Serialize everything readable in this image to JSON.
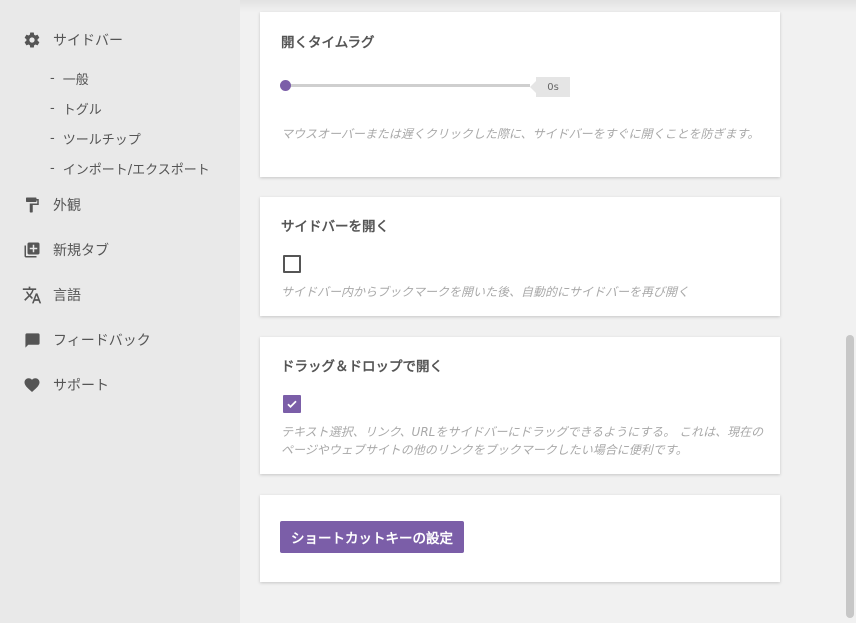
{
  "sidebar": {
    "items": [
      {
        "label": "サイドバー",
        "icon": "gear-icon"
      },
      {
        "label": "外観",
        "icon": "paint-roller-icon"
      },
      {
        "label": "新規タブ",
        "icon": "new-tab-icon"
      },
      {
        "label": "言語",
        "icon": "translate-icon"
      },
      {
        "label": "フィードバック",
        "icon": "comment-icon"
      },
      {
        "label": "サポート",
        "icon": "heart-icon"
      }
    ],
    "sub_items": [
      {
        "label": "一般"
      },
      {
        "label": "トグル"
      },
      {
        "label": "ツールチップ"
      },
      {
        "label": "インポート/エクスポート"
      }
    ],
    "sub_dash": "-"
  },
  "open_delay": {
    "title": "開くタイムラグ",
    "value_label": "0s",
    "value": 0,
    "description": "マウスオーバーまたは遅くクリックした際に、サイドバーをすぐに開くことを防ぎます。"
  },
  "open_sidebar": {
    "title": "サイドバーを開く",
    "checked": false,
    "description": "サイドバー内からブックマークを開いた後、自動的にサイドバーを再び開く"
  },
  "drag_drop": {
    "title": "ドラッグ＆ドロップで開く",
    "checked": true,
    "description": "テキスト選択、リンク、URLをサイドバーにドラッグできるようにする。 これは、現在のページやウェブサイトの他のリンクをブックマークしたい場合に便利です。"
  },
  "shortcut": {
    "button_label": "ショートカットキーの設定"
  },
  "colors": {
    "accent": "#7b5ea8",
    "sidebar_bg": "#e9e9e9",
    "page_bg": "#f1f1f1"
  }
}
